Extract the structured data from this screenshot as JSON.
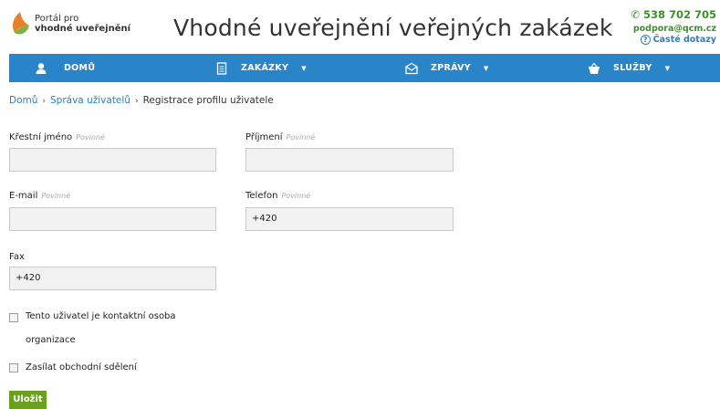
{
  "header": {
    "logo_line1": "Portál pro",
    "logo_line2": "vhodné uveřejnění",
    "title": "Vhodné uveřejnění veřejných zakázek",
    "phone": "538 702 705",
    "email": "podpora@qcm.cz",
    "faq": "Časté dotazy"
  },
  "nav": {
    "items": [
      {
        "label": "DOMŮ",
        "icon": "user-icon"
      },
      {
        "label": "ZAKÁZKY",
        "icon": "document-icon"
      },
      {
        "label": "ZPRÁVY",
        "icon": "envelope-icon"
      },
      {
        "label": "SLUŽBY",
        "icon": "basket-icon"
      }
    ]
  },
  "breadcrumb": {
    "home": "Domů",
    "users": "Správa uživatelů",
    "current": "Registrace profilu uživatele"
  },
  "form": {
    "first_name": {
      "label": "Křestní jméno",
      "required": "Povinné",
      "value": ""
    },
    "last_name": {
      "label": "Příjmení",
      "required": "Povinné",
      "value": ""
    },
    "email": {
      "label": "E-mail",
      "required": "Povinné",
      "value": ""
    },
    "phone": {
      "label": "Telefon",
      "required": "Povinné",
      "value": "+420"
    },
    "fax": {
      "label": "Fax",
      "value": "+420"
    },
    "contact_person_line1": "Tento uživatel je kontaktní osoba",
    "contact_person_line2": "organizace",
    "newsletter": "Zasílat obchodní sdělení",
    "save": "Uložit"
  },
  "colors": {
    "nav": "#2a84c8",
    "accent_green": "#3f8f2a",
    "save_button": "#6a9f1f",
    "link": "#2a7fc0"
  }
}
